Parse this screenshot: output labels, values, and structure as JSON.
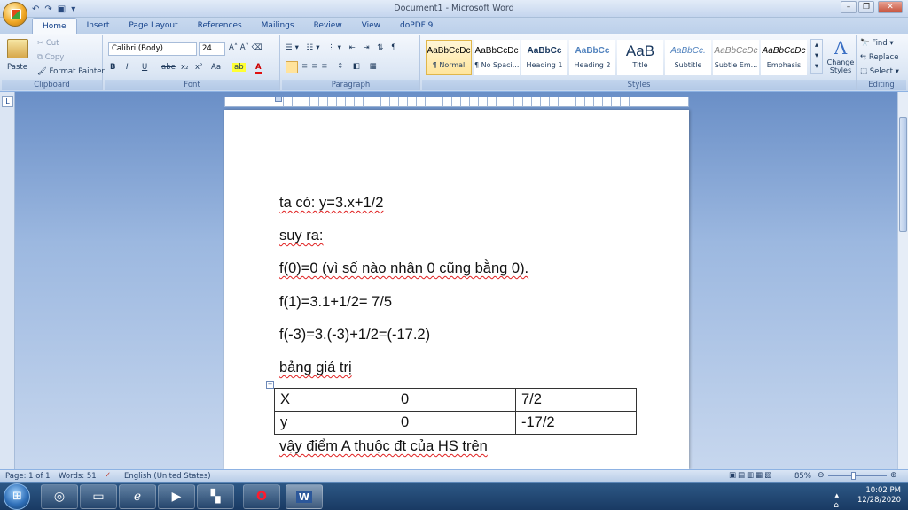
{
  "window": {
    "title": "Document1 - Microsoft Word"
  },
  "qat": {
    "undo_icon": "undo-icon",
    "redo_icon": "redo-icon",
    "save_icon": "save-icon"
  },
  "tabs": [
    {
      "label": "Home"
    },
    {
      "label": "Insert"
    },
    {
      "label": "Page Layout"
    },
    {
      "label": "References"
    },
    {
      "label": "Mailings"
    },
    {
      "label": "Review"
    },
    {
      "label": "View"
    },
    {
      "label": "doPDF 9"
    }
  ],
  "clipboard": {
    "paste": "Paste",
    "cut": "Cut",
    "copy": "Copy",
    "format_painter": "Format Painter",
    "group": "Clipboard"
  },
  "font": {
    "name": "Calibri (Body)",
    "size": "24",
    "group": "Font"
  },
  "paragraph": {
    "group": "Paragraph"
  },
  "styles": {
    "group": "Styles",
    "items": [
      {
        "preview": "AaBbCcDc",
        "name": "¶ Normal"
      },
      {
        "preview": "AaBbCcDc",
        "name": "¶ No Spaci..."
      },
      {
        "preview": "AaBbCc",
        "name": "Heading 1"
      },
      {
        "preview": "AaBbCc",
        "name": "Heading 2"
      },
      {
        "preview": "AaB",
        "name": "Title"
      },
      {
        "preview": "AaBbCc.",
        "name": "Subtitle"
      },
      {
        "preview": "AaBbCcDc",
        "name": "Subtle Em..."
      },
      {
        "preview": "AaBbCcDc",
        "name": "Emphasis"
      }
    ],
    "change_styles": "Change Styles"
  },
  "editing": {
    "find": "Find",
    "replace": "Replace",
    "select": "Select",
    "group": "Editing"
  },
  "document": {
    "lines": [
      "ta có: y=3.x+1/2",
      "suy ra:",
      "f(0)=0 (vì số nào nhân 0 cũng bằng 0).",
      "f(1)=3.1+1/2= 7/5",
      "f(-3)=3.(-3)+1/2=(-17.2)",
      "bảng giá trị"
    ],
    "table": [
      [
        "X",
        "0",
        "7/2"
      ],
      [
        "y",
        "0",
        "-17/2"
      ]
    ],
    "closing": "vậy điểm A thuộc đt của HS trên"
  },
  "status": {
    "page": "Page: 1 of 1",
    "words": "Words: 51",
    "language": "English (United States)",
    "zoom": "85%"
  },
  "taskbar": {
    "time": "10:02 PM",
    "date": "12/28/2020"
  }
}
